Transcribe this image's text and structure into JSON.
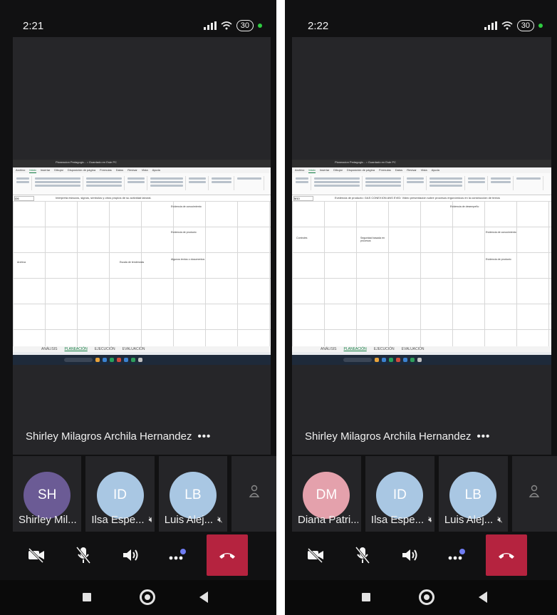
{
  "colors": {
    "background": "#111112",
    "tile": "#252528",
    "hangup": "#b5233f",
    "excel_green": "#107c41"
  },
  "phones": [
    {
      "time": "2:21",
      "battery": "30",
      "speaker_name": "Shirley Milagros Archila Hernandez",
      "more_label": "•••",
      "excel": {
        "title": "Planeacion Pedagogic... • Guardado en Este PC",
        "cell_ref": "I26",
        "formula": "Interpreta esbozos, signos, símbolos y otros propios de su actividad laboral.",
        "sheets": [
          "ANÁLISIS",
          "PLANEACIÓN",
          "EJECUCIÓN",
          "EVALUACIÓN"
        ]
      },
      "tiles": [
        {
          "initials": "SH",
          "name": "Shirley Mil...",
          "color": "#6b5b95",
          "muted": false
        },
        {
          "initials": "ID",
          "name": "Ilsa Espe...",
          "color": "#a9c7e3",
          "muted": true
        },
        {
          "initials": "LB",
          "name": "Luis Alej...",
          "color": "#a9c7e3",
          "muted": true
        }
      ]
    },
    {
      "time": "2:22",
      "battery": "30",
      "speaker_name": "Shirley Milagros Archila Hernandez",
      "more_label": "•••",
      "excel": {
        "title": "Planeacion Pedagogic... • Guardado en Este PC",
        "cell_ref": "M10",
        "formula": "Evidencia de producto: GAS CONEXION ANS EVID: Video presentación sobre procesos ergonómicos en la construcción de textos",
        "sheets": [
          "ANÁLISIS",
          "PLANEACIÓN",
          "EJECUCIÓN",
          "EVALUACIÓN"
        ]
      },
      "tiles": [
        {
          "initials": "DM",
          "name": "Diana Patri...",
          "color": "#e4a1ac",
          "muted": false
        },
        {
          "initials": "ID",
          "name": "Ilsa Espe...",
          "color": "#a9c7e3",
          "muted": true
        },
        {
          "initials": "LB",
          "name": "Luis Alej...",
          "color": "#a9c7e3",
          "muted": true
        }
      ]
    }
  ]
}
